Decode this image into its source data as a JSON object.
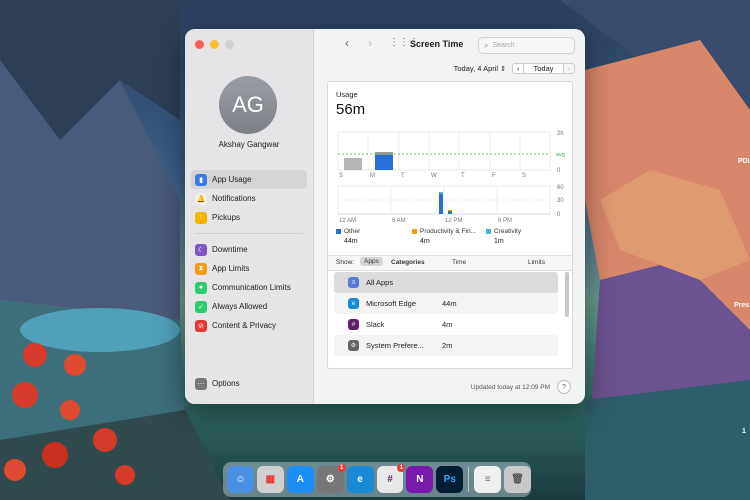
{
  "desktop": {
    "right_labels": [
      "PDI",
      "Pres",
      "1"
    ]
  },
  "window": {
    "title": "Screen Time",
    "search_placeholder": "Search",
    "user": {
      "initials": "AG",
      "name": "Akshay Gangwar"
    },
    "sidebar": {
      "group1": [
        {
          "label": "App Usage",
          "icon": "bar-chart-icon",
          "color": "#3b7be0",
          "active": true
        },
        {
          "label": "Notifications",
          "icon": "bell-icon",
          "color": "#e8e8e8",
          "active": false
        },
        {
          "label": "Pickups",
          "icon": "pickup-icon",
          "color": "#f5b400",
          "active": false
        }
      ],
      "group2": [
        {
          "label": "Downtime",
          "icon": "moon-icon",
          "color": "#7e57c2"
        },
        {
          "label": "App Limits",
          "icon": "hourglass-icon",
          "color": "#f39c12"
        },
        {
          "label": "Communication Limits",
          "icon": "person-icon",
          "color": "#2ecc71"
        },
        {
          "label": "Always Allowed",
          "icon": "checkmark-icon",
          "color": "#2ecc71"
        },
        {
          "label": "Content & Privacy",
          "icon": "no-entry-icon",
          "color": "#e53935"
        }
      ],
      "options_label": "Options"
    },
    "date_label": "Today, 4 April",
    "today_button": "Today",
    "usage_label": "Usage",
    "usage_value": "56m",
    "weekly_chart": {
      "days": [
        "S",
        "M",
        "T",
        "W",
        "T",
        "F",
        "S"
      ],
      "y_labels": [
        "2h",
        "avg",
        "0"
      ],
      "avg_label": "avg"
    },
    "hourly_chart": {
      "x_labels": [
        "12 AM",
        "6 AM",
        "12 PM",
        "6 PM"
      ],
      "y_labels": [
        "60",
        "30",
        "0"
      ]
    },
    "legend": [
      {
        "label": "Other",
        "value": "44m",
        "color": "#2b6fd6"
      },
      {
        "label": "Productivity & Fin...",
        "value": "4m",
        "color": "#f39c12"
      },
      {
        "label": "Creativity",
        "value": "1m",
        "color": "#45b6d8"
      }
    ],
    "show_bar": {
      "show": "Show:",
      "apps": "Apps",
      "categories": "Categories",
      "time": "Time",
      "limits": "Limits"
    },
    "rows": [
      {
        "name": "All Apps",
        "time": "",
        "icon": "stack-icon",
        "color": "#5a7bd6"
      },
      {
        "name": "Microsoft Edge",
        "time": "44m",
        "icon": "edge-icon",
        "color": "#1a8ad4"
      },
      {
        "name": "Slack",
        "time": "4m",
        "icon": "slack-icon",
        "color": "#611f69"
      },
      {
        "name": "System Prefere...",
        "time": "2m",
        "icon": "gear-icon",
        "color": "#666666"
      }
    ],
    "footer": "Updated today at 12:09 PM",
    "help": "?"
  },
  "dock": [
    {
      "name": "Finder",
      "glyph": "☺",
      "color": "#4a90e2",
      "badge": ""
    },
    {
      "name": "Launchpad",
      "glyph": "▦",
      "color": "#d0d0d0",
      "badge": ""
    },
    {
      "name": "App Store",
      "glyph": "A",
      "color": "#1c8ef9",
      "badge": ""
    },
    {
      "name": "System Preferences",
      "glyph": "⚙",
      "color": "#777777",
      "badge": "1"
    },
    {
      "name": "Microsoft Edge",
      "glyph": "e",
      "color": "#1a8ad4",
      "badge": ""
    },
    {
      "name": "Slack",
      "glyph": "#",
      "color": "#e8e8e8",
      "badge": "1"
    },
    {
      "name": "OneNote",
      "glyph": "N",
      "color": "#7719aa",
      "badge": ""
    },
    {
      "name": "Photoshop",
      "glyph": "Ps",
      "color": "#001d34",
      "badge": ""
    },
    {
      "name": "Document",
      "glyph": "≡",
      "color": "#f0f0f0",
      "badge": ""
    },
    {
      "name": "Trash",
      "glyph": "🗑",
      "color": "#c8c8c8",
      "badge": ""
    }
  ]
}
